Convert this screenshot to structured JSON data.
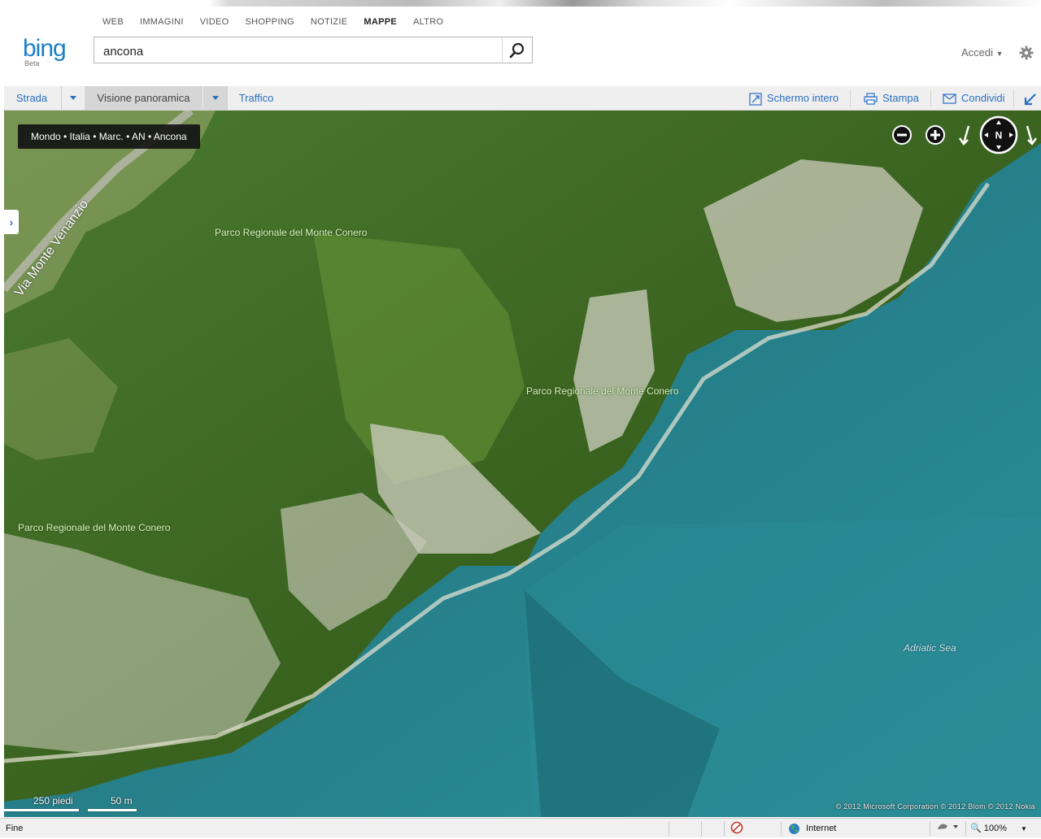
{
  "header": {
    "nav": [
      "WEB",
      "IMMAGINI",
      "VIDEO",
      "SHOPPING",
      "NOTIZIE",
      "MAPPE",
      "ALTRO"
    ],
    "active_nav": "MAPPE",
    "logo_text": "bing",
    "logo_sub": "Beta",
    "search_value": "ancona",
    "signin_label": "Accedi"
  },
  "toolbar": {
    "left": [
      "Strada",
      "Visione panoramica",
      "Traffico"
    ],
    "selected": "Visione panoramica",
    "right": [
      "Schermo intero",
      "Stampa",
      "Condividi"
    ]
  },
  "map": {
    "breadcrumb": "Mondo • Italia • Marc. • AN • Ancona",
    "compass_label": "N",
    "labels": {
      "park_1": "Parco Regionale del Monte Conero",
      "park_2": "Parco Regionale del Monte Conero",
      "park_3": "Parco Regionale del Monte Conero",
      "sea": "Adriatic Sea",
      "road": "Via Monte Venanzio"
    },
    "scale_imperial": "250 piedi",
    "scale_metric": "50 m",
    "copyright": "© 2012 Microsoft Corporation   © 2012 Blom   © 2012 Nokia"
  },
  "statusbar": {
    "status": "Fine",
    "zone": "Internet",
    "zoom": "100%"
  },
  "colors": {
    "accent": "#2a6fc4",
    "bing_blue": "#1a7fc6",
    "sea": "#1f7d88",
    "forest": "#3e6a22"
  }
}
